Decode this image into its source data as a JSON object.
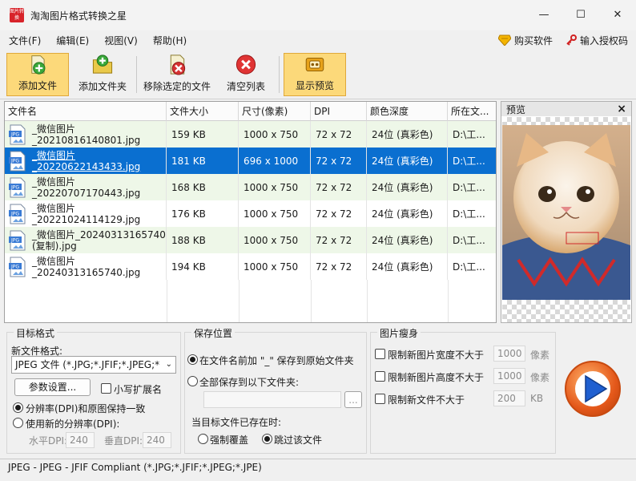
{
  "window": {
    "title": "淘淘图片格式转换之星",
    "app_icon_text": "图片转换",
    "minimize": "—",
    "maximize": "☐",
    "close": "✕"
  },
  "menu": {
    "items": [
      "文件(F)",
      "编辑(E)",
      "视图(V)",
      "帮助(H)"
    ],
    "buy": "购买软件",
    "license": "输入授权码"
  },
  "toolbar": {
    "add_file": "添加文件",
    "add_folder": "添加文件夹",
    "remove_selected": "移除选定的文件",
    "clear_list": "清空列表",
    "show_preview": "显示预览"
  },
  "file_list": {
    "columns": [
      "文件名",
      "文件大小",
      "尺寸(像素)",
      "DPI",
      "颜色深度",
      "所在文..."
    ],
    "rows": [
      {
        "name1": "_微信图片",
        "name2": "_20210816140801.jpg",
        "size": "159 KB",
        "dims": "1000 x 750",
        "dpi": "72 x 72",
        "depth": "24位 (真彩色)",
        "path": "D:\\工..."
      },
      {
        "name1": "_微信图片",
        "name2": "_20220622143433.jpg",
        "size": "181 KB",
        "dims": "696 x 1000",
        "dpi": "72 x 72",
        "depth": "24位 (真彩色)",
        "path": "D:\\工..."
      },
      {
        "name1": "_微信图片",
        "name2": "_20220707170443.jpg",
        "size": "168 KB",
        "dims": "1000 x 750",
        "dpi": "72 x 72",
        "depth": "24位 (真彩色)",
        "path": "D:\\工..."
      },
      {
        "name1": "_微信图片",
        "name2": "_20221024114129.jpg",
        "size": "176 KB",
        "dims": "1000 x 750",
        "dpi": "72 x 72",
        "depth": "24位 (真彩色)",
        "path": "D:\\工..."
      },
      {
        "name1": "_微信图片_20240313165740",
        "name2": "(复制).jpg",
        "size": "188 KB",
        "dims": "1000 x 750",
        "dpi": "72 x 72",
        "depth": "24位 (真彩色)",
        "path": "D:\\工..."
      },
      {
        "name1": "_微信图片",
        "name2": "_20240313165740.jpg",
        "size": "194 KB",
        "dims": "1000 x 750",
        "dpi": "72 x 72",
        "depth": "24位 (真彩色)",
        "path": "D:\\工..."
      }
    ],
    "file_icon_label": "JPG"
  },
  "preview": {
    "title": "预览",
    "close": "×"
  },
  "target_format": {
    "title": "目标格式",
    "new_format_label": "新文件格式:",
    "format_value": "JPEG 文件 (*.JPG;*.JFIF;*.JPEG;*",
    "params_button": "参数设置...",
    "lowercase_ext": "小写扩展名",
    "keep_dpi": "分辨率(DPI)和原图保持一致",
    "new_dpi": "使用新的分辨率(DPI):",
    "h_dpi_label": "水平DPI:",
    "h_dpi_value": "240",
    "v_dpi_label": "垂直DPI:",
    "v_dpi_value": "240"
  },
  "save_location": {
    "title": "保存位置",
    "option_prefix": "在文件名前加 \"_\" 保存到原始文件夹",
    "option_folder": "全部保存到以下文件夹:",
    "browse": "...",
    "exists_label": "当目标文件已存在时:",
    "overwrite": "强制覆盖",
    "skip": "跳过该文件"
  },
  "slim": {
    "title": "图片瘦身",
    "limit_width": "限制新图片宽度不大于",
    "width_value": "1000",
    "width_unit": "像素",
    "limit_height": "限制新图片高度不大于",
    "height_value": "1000",
    "height_unit": "像素",
    "limit_size": "限制新文件不大于",
    "size_value": "200",
    "size_unit": "KB"
  },
  "status": "JPEG - JPEG - JFIF Compliant (*.JPG;*.JFIF;*.JPEG;*.JPE)",
  "colors": {
    "selected_row": "#0a6fd0",
    "even_row": "#eef7e8",
    "active_tool": "#fcd97a",
    "accent_orange": "#e4581a"
  }
}
